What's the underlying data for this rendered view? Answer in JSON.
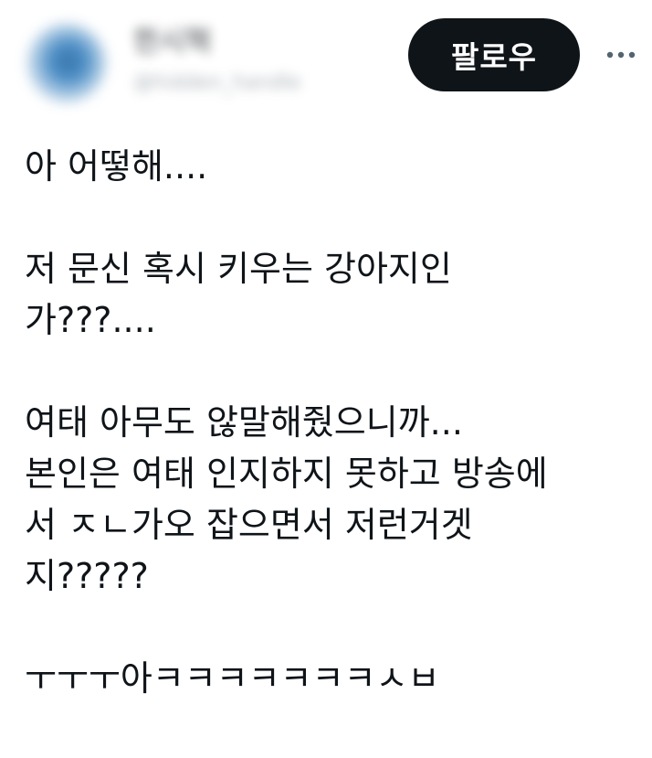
{
  "header": {
    "display_name": "한시혁",
    "handle": "@hidden_handle",
    "follow_label": "팔로우",
    "more_icon": "more-horizontal-icon"
  },
  "tweet": {
    "text": "아 어떻해....\n\n저 문신 혹시 키우는 강아지인\n가???....\n\n여태 아무도 않말해줬으니까...\n본인은 여태 인지하지 못하고 방송에\n서 ㅈㄴ가오 잡으면서 저런거겟\n지?????\n\nㅜㅜㅜ아ㅋㅋㅋㅋㅋㅋㅋㅅㅂ"
  },
  "colors": {
    "text": "#0f1419",
    "secondary": "#536471",
    "button_bg": "#0f1419",
    "button_text": "#ffffff"
  }
}
